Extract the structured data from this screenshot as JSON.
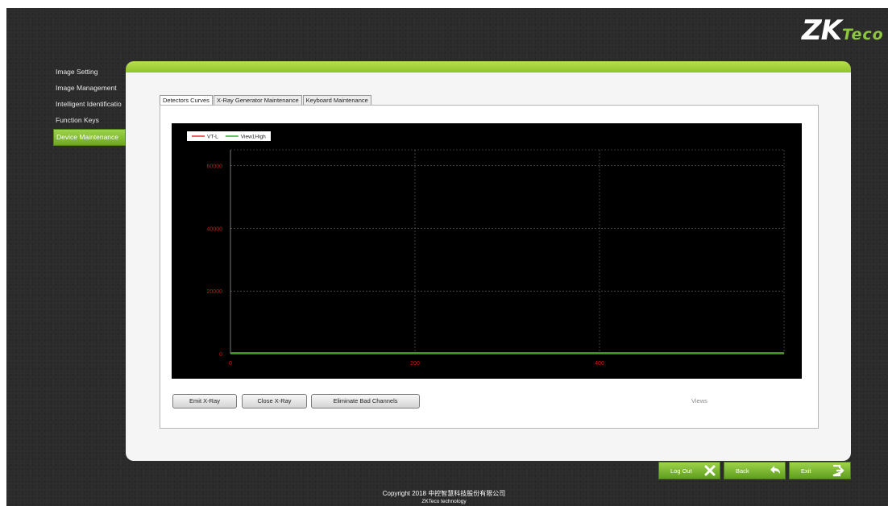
{
  "logo": {
    "zk": "ZK",
    "eco": "Teco"
  },
  "sidebar": {
    "items": [
      {
        "label": "Image Setting",
        "active": false
      },
      {
        "label": "Image Management",
        "active": false
      },
      {
        "label": "Intelligent Identificatio",
        "active": false
      },
      {
        "label": "Function Keys",
        "active": false
      },
      {
        "label": "Device Maintenance",
        "active": true
      }
    ]
  },
  "tabs": [
    {
      "label": "Detectors Curves",
      "active": true
    },
    {
      "label": "X-Ray Generator Maintenance",
      "active": false
    },
    {
      "label": "Keyboard Maintenance",
      "active": false
    }
  ],
  "chart_data": {
    "type": "line",
    "x_ticks": [
      0,
      200,
      400
    ],
    "y_ticks": [
      0,
      20000,
      40000,
      60000
    ],
    "xlim": [
      0,
      600
    ],
    "ylim": [
      0,
      65000
    ],
    "grid": true,
    "legend": "top-left",
    "series": [
      {
        "name": "VT-L",
        "color": "#e0202a",
        "x": [
          0,
          600
        ],
        "y": [
          0,
          0
        ]
      },
      {
        "name": "View1High",
        "color": "#2fae2f",
        "x": [
          0,
          600
        ],
        "y": [
          0,
          0
        ]
      }
    ],
    "xlabel": "Views",
    "background": "#000000",
    "tick_color": "#e01010"
  },
  "buttons": {
    "emit": "Emit X-Ray",
    "close": "Close X-Ray",
    "eliminate": "Eliminate Bad Channels"
  },
  "actions": {
    "logout": "Log Out",
    "back": "Back",
    "exit": "Exit"
  },
  "footer": {
    "copyright": "Copyright 2018  中控智慧科技股份有限公司",
    "company": "ZKTeco technology"
  },
  "colors": {
    "accent_green": "#8cbf27",
    "background": "#2b2b2b"
  }
}
